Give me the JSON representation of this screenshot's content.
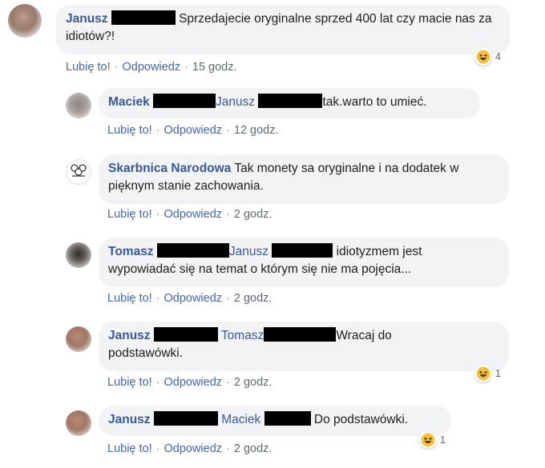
{
  "comments": [
    {
      "author": "Janusz",
      "text": "Sprzedajecie oryginalne sprzed 400 lat czy macie nas za idiotów?!",
      "like_label": "Lubię to!",
      "reply_label": "Odpowiedz",
      "time": "15 godz.",
      "reaction_count": "4"
    },
    {
      "author": "Maciek",
      "mention": "Janusz",
      "text": "tak.warto to umieć.",
      "like_label": "Lubię to!",
      "reply_label": "Odpowiedz",
      "time": "12 godz."
    },
    {
      "author": "Skarbnica Narodowa",
      "text": "Tak monety sa oryginalne i na dodatek w pięknym stanie zachowania.",
      "like_label": "Lubię to!",
      "reply_label": "Odpowiedz",
      "time": "2 godz."
    },
    {
      "author": "Tomasz",
      "mention": "Janusz",
      "text_line1": "idiotyzmem jest",
      "text_line2": "wypowiadać się na temat o którym się nie ma pojęcia...",
      "like_label": "Lubię to!",
      "reply_label": "Odpowiedz",
      "time": "2 godz."
    },
    {
      "author": "Janusz",
      "mention": "Tomasz",
      "text_line1": "Wracaj do",
      "text_line2": "podstawówki.",
      "like_label": "Lubię to!",
      "reply_label": "Odpowiedz",
      "time": "2 godz.",
      "reaction_count": "1"
    },
    {
      "author": "Janusz",
      "mention": "Maciek",
      "text": "Do podstawówki.",
      "like_label": "Lubię to!",
      "reply_label": "Odpowiedz",
      "time": "2 godz.",
      "reaction_count": "1"
    }
  ],
  "colors": {
    "name": "#385898",
    "link": "#4267b2",
    "bubble": "#f2f3f5",
    "meta": "#606770"
  },
  "icons": {
    "avatar": "blurred-profile-photo",
    "page_avatar": "coin-logo",
    "reaction": "haha-emoji"
  }
}
